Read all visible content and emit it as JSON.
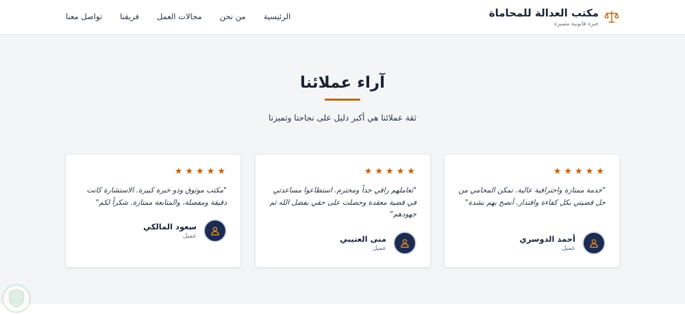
{
  "brand": {
    "title": "مكتب العدالة للمحاماة",
    "subtitle": "خبرة قانونية متميزة",
    "logo_icon": "scales-icon",
    "accent": "#c0660e"
  },
  "nav": {
    "items": [
      {
        "label": "الرئيسية"
      },
      {
        "label": "من نحن"
      },
      {
        "label": "مجالات العمل"
      },
      {
        "label": "فريقنا"
      },
      {
        "label": "تواصل معنا"
      }
    ]
  },
  "section": {
    "title": "آراء عملائنا",
    "subtitle": "ثقة عملائنا هي أكبر دليل على نجاحنا وتميزنا"
  },
  "testimonials": [
    {
      "rating": 5,
      "quote": "\"خدمة ممتازة واحترافية عالية. تمكن المحامي من حل قضيتي بكل كفاءة واقتدار. أنصح بهم بشدة\"",
      "name": "أحمد الدوسري",
      "role": "عميل",
      "avatar_icon": "user-icon"
    },
    {
      "rating": 5,
      "quote": "\"تعاملهم راقي جداً ومحترم. استطاعوا مساعدتي في قضية معقدة وحصلت على حقي بفضل الله ثم جهودهم\"",
      "name": "منى العتيبي",
      "role": "عميل",
      "avatar_icon": "user-icon"
    },
    {
      "rating": 5,
      "quote": "\"مكتب موثوق وذو خبرة كبيرة. الاستشارة كانت دقيقة ومفصلة، والمتابعة ممتازة. شكراً لكم\"",
      "name": "سعود المالكي",
      "role": "عميل",
      "avatar_icon": "user-icon"
    }
  ],
  "colors": {
    "navy": "#1c2b52",
    "star": "#c0660e",
    "background": "#f4f5f7"
  }
}
